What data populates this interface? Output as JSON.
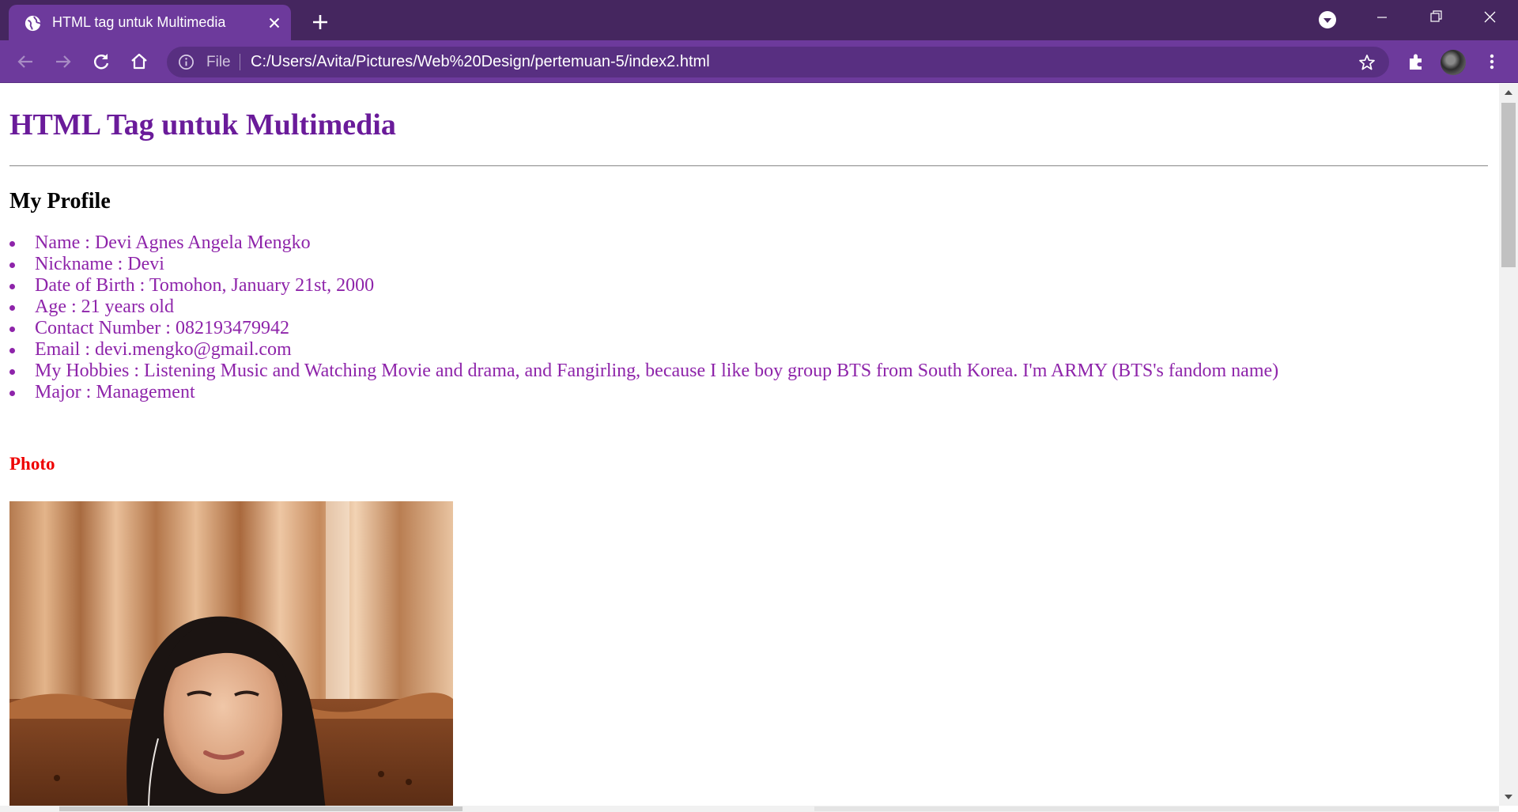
{
  "browser": {
    "tab": {
      "title": "HTML tag untuk Multimedia"
    },
    "address_bar": {
      "scheme_label": "File",
      "url": "C:/Users/Avita/Pictures/Web%20Design/pertemuan-5/index2.html"
    },
    "colors": {
      "frame": "#45265f",
      "toolbar": "#6d3a9c",
      "omnibox": "#582f81"
    }
  },
  "page": {
    "heading": "HTML Tag untuk Multimedia",
    "profile_heading": "My Profile",
    "profile_items": [
      "Name : Devi Agnes Angela Mengko",
      "Nickname : Devi",
      "Date of Birth : Tomohon, January 21st, 2000",
      "Age : 21 years old",
      "Contact Number : 082193479942",
      "Email : devi.mengko@gmail.com",
      "My Hobbies : Listening Music and Watching Movie and drama, and Fangirling, because I like boy group BTS from South Korea. I'm ARMY (BTS's fandom name)",
      "Major : Management"
    ],
    "photo_heading": "Photo",
    "colors": {
      "heading": "#6a1b9a",
      "list": "#8e24aa",
      "photo_heading": "#ee0000"
    }
  }
}
